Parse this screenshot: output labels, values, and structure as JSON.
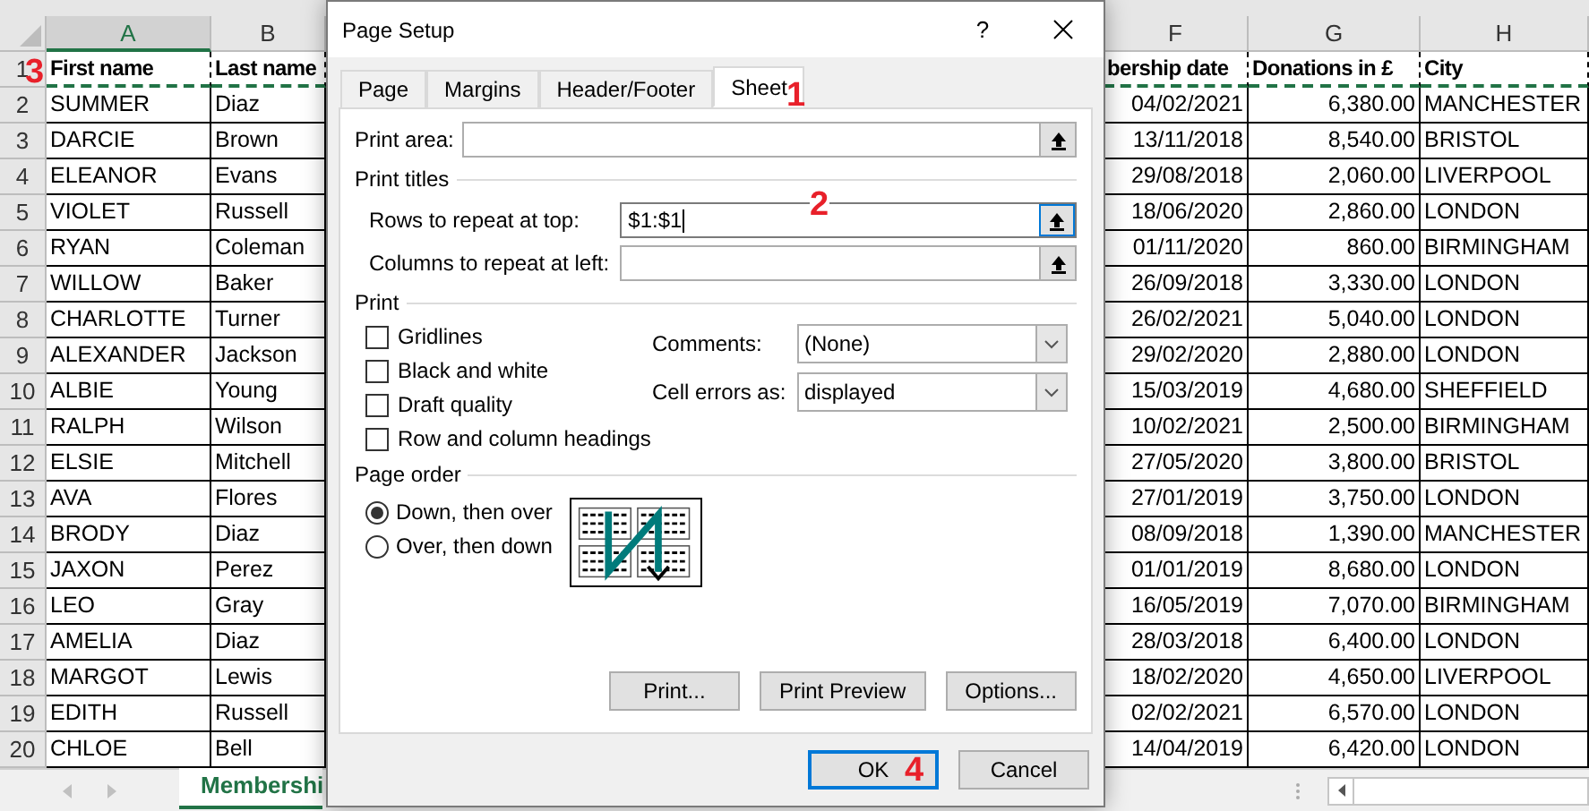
{
  "sheet": {
    "left_columns": [
      {
        "letter": "A"
      },
      {
        "letter": "B"
      }
    ],
    "right_columns": [
      {
        "letter": "F",
        "kind": "number"
      },
      {
        "letter": "G",
        "kind": "number"
      },
      {
        "letter": "H",
        "kind": "text"
      }
    ],
    "header_row": {
      "number": "1",
      "cells": [
        "First name",
        "Last name",
        "bership date",
        "Donations in £",
        "City"
      ]
    },
    "rows": [
      {
        "number": "2",
        "cells": [
          "SUMMER",
          "Diaz",
          "04/02/2021",
          "6,380.00",
          "MANCHESTER"
        ]
      },
      {
        "number": "3",
        "cells": [
          "DARCIE",
          "Brown",
          "13/11/2018",
          "8,540.00",
          "BRISTOL"
        ]
      },
      {
        "number": "4",
        "cells": [
          "ELEANOR",
          "Evans",
          "29/08/2018",
          "2,060.00",
          "LIVERPOOL"
        ]
      },
      {
        "number": "5",
        "cells": [
          "VIOLET",
          "Russell",
          "18/06/2020",
          "2,860.00",
          "LONDON"
        ]
      },
      {
        "number": "6",
        "cells": [
          "RYAN",
          "Coleman",
          "01/11/2020",
          "860.00",
          "BIRMINGHAM"
        ]
      },
      {
        "number": "7",
        "cells": [
          "WILLOW",
          "Baker",
          "26/09/2018",
          "3,330.00",
          "LONDON"
        ]
      },
      {
        "number": "8",
        "cells": [
          "CHARLOTTE",
          "Turner",
          "26/02/2021",
          "5,040.00",
          "LONDON"
        ]
      },
      {
        "number": "9",
        "cells": [
          "ALEXANDER",
          "Jackson",
          "29/02/2020",
          "2,880.00",
          "LONDON"
        ]
      },
      {
        "number": "10",
        "cells": [
          "ALBIE",
          "Young",
          "15/03/2019",
          "4,680.00",
          "SHEFFIELD"
        ]
      },
      {
        "number": "11",
        "cells": [
          "RALPH",
          "Wilson",
          "10/02/2021",
          "2,500.00",
          "BIRMINGHAM"
        ]
      },
      {
        "number": "12",
        "cells": [
          "ELSIE",
          "Mitchell",
          "27/05/2020",
          "3,800.00",
          "BRISTOL"
        ]
      },
      {
        "number": "13",
        "cells": [
          "AVA",
          "Flores",
          "27/01/2019",
          "3,750.00",
          "LONDON"
        ]
      },
      {
        "number": "14",
        "cells": [
          "BRODY",
          "Diaz",
          "08/09/2018",
          "1,390.00",
          "MANCHESTER"
        ]
      },
      {
        "number": "15",
        "cells": [
          "JAXON",
          "Perez",
          "01/01/2019",
          "8,680.00",
          "LONDON"
        ]
      },
      {
        "number": "16",
        "cells": [
          "LEO",
          "Gray",
          "16/05/2019",
          "7,070.00",
          "BIRMINGHAM"
        ]
      },
      {
        "number": "17",
        "cells": [
          "AMELIA",
          "Diaz",
          "28/03/2018",
          "6,400.00",
          "LONDON"
        ]
      },
      {
        "number": "18",
        "cells": [
          "MARGOT",
          "Lewis",
          "18/02/2020",
          "4,650.00",
          "LIVERPOOL"
        ]
      },
      {
        "number": "19",
        "cells": [
          "EDITH",
          "Russell",
          "02/02/2021",
          "6,570.00",
          "LONDON"
        ]
      },
      {
        "number": "20",
        "cells": [
          "CHLOE",
          "Bell",
          "14/04/2019",
          "6,420.00",
          "LONDON"
        ]
      }
    ],
    "sheet_tab": {
      "label": "Membershi",
      "selected": true
    }
  },
  "dialog": {
    "title": "Page Setup",
    "help": "?",
    "tabs": [
      {
        "label": "Page",
        "selected": false
      },
      {
        "label": "Margins",
        "selected": false
      },
      {
        "label": "Header/Footer",
        "selected": false
      },
      {
        "label": "Sheet",
        "selected": true
      }
    ],
    "print_area": {
      "label": "Print area:"
    },
    "print_titles": {
      "heading": "Print titles",
      "fields": [
        {
          "label": "Rows to repeat at top:",
          "value": "$1:$1",
          "focused": true
        },
        {
          "label": "Columns to repeat at left:",
          "focused": false
        }
      ]
    },
    "print": {
      "heading": "Print",
      "checkboxes": [
        {
          "label": "Gridlines",
          "checked": false
        },
        {
          "label": "Black and white",
          "checked": false
        },
        {
          "label": "Draft quality",
          "checked": false
        },
        {
          "label": "Row and column headings",
          "checked": false
        }
      ],
      "selects": [
        {
          "label": "Comments:",
          "value": "(None)"
        },
        {
          "label": "Cell errors as:",
          "value": "displayed"
        }
      ]
    },
    "page_order": {
      "heading": "Page order",
      "options": [
        {
          "label": "Down, then over",
          "selected": true
        },
        {
          "label": "Over, then down",
          "selected": false
        }
      ]
    },
    "buttons": [
      {
        "label": "Print..."
      },
      {
        "label": "Print Preview"
      },
      {
        "label": "Options..."
      }
    ],
    "footer_buttons": [
      {
        "label": "OK",
        "default": true
      },
      {
        "label": "Cancel",
        "default": false
      }
    ]
  },
  "annotations": [
    {
      "text": "1"
    },
    {
      "text": "2"
    },
    {
      "text": "3"
    },
    {
      "text": "4"
    }
  ]
}
